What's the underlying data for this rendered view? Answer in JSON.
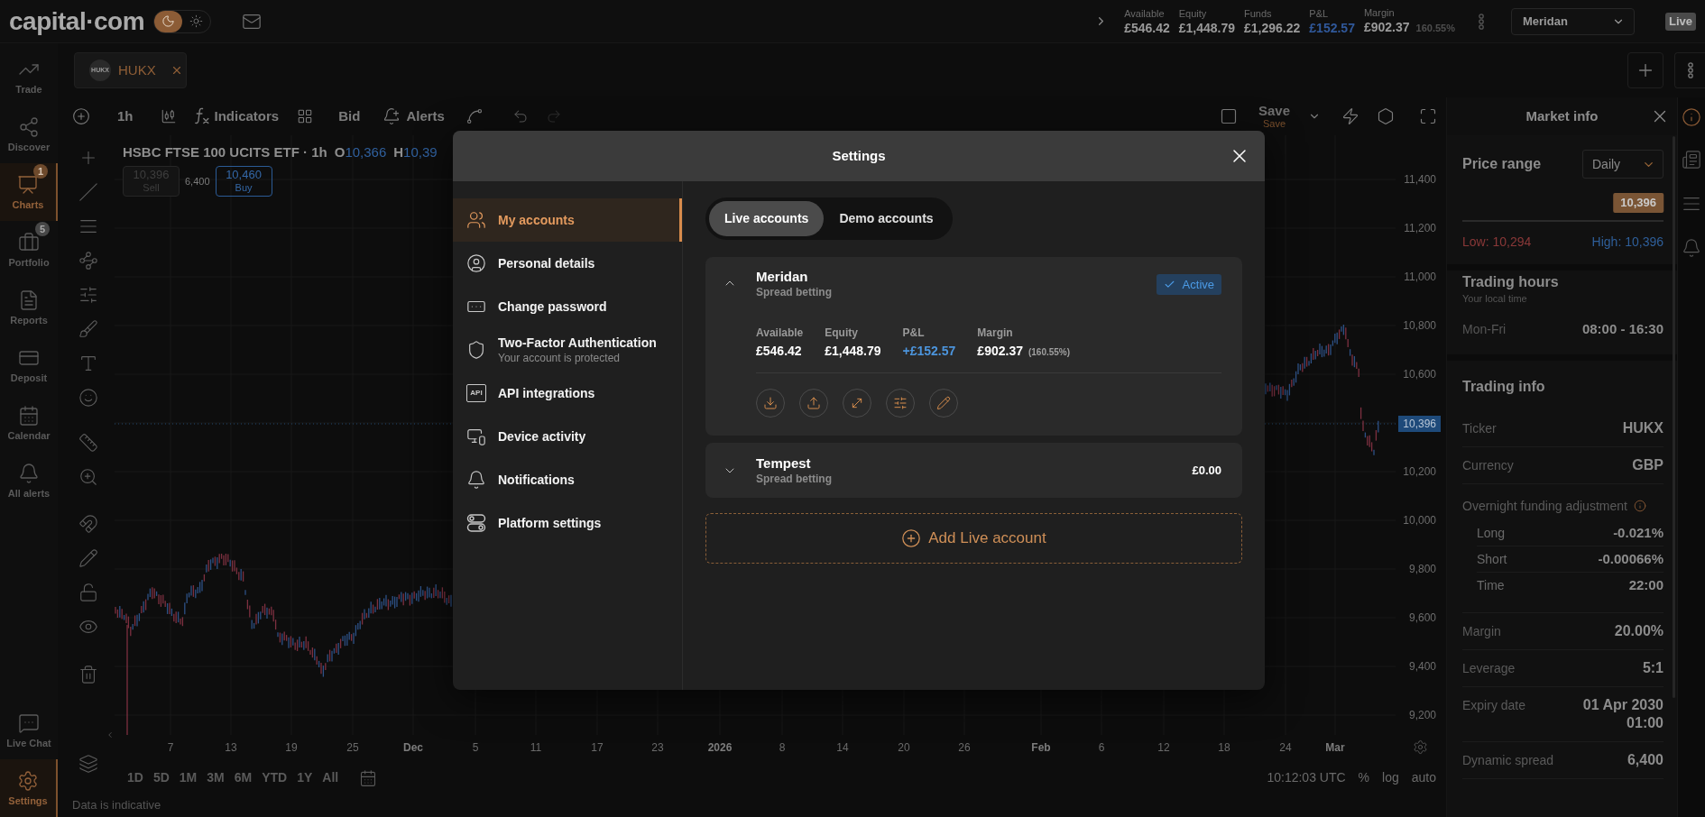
{
  "top_bar": {
    "logo": "capital·com",
    "theme_toggle": [
      {
        "kind": "dark",
        "selected": true
      },
      {
        "kind": "light",
        "selected": false
      }
    ],
    "summary": [
      {
        "label": "Available",
        "value": "£546.42",
        "kind": "amount"
      },
      {
        "label": "Equity",
        "value": "£1,448.79",
        "kind": "amount"
      },
      {
        "label": "Funds",
        "value": "£1,296.22",
        "kind": "amount"
      },
      {
        "label": "P&L",
        "value": "£152.57",
        "kind": "profit"
      },
      {
        "label": "Margin",
        "value": "£902.37",
        "note": "160.55%",
        "kind": "amount"
      }
    ],
    "account_select": {
      "value": "Meridan"
    },
    "mode_badge": "Live"
  },
  "sidebar": {
    "items": [
      {
        "label": "Trade",
        "selected": false
      },
      {
        "label": "Discover",
        "selected": false
      },
      {
        "label": "Charts",
        "selected": true,
        "badge": "1"
      },
      {
        "label": "Portfolio",
        "selected": false,
        "badge": "5"
      },
      {
        "label": "Reports",
        "selected": false
      },
      {
        "label": "Deposit",
        "selected": false
      },
      {
        "label": "Calendar",
        "selected": false
      },
      {
        "label": "All alerts",
        "selected": false
      }
    ],
    "bottom_items": [
      {
        "label": "Live Chat",
        "selected": false
      },
      {
        "label": "Settings",
        "selected": true
      }
    ]
  },
  "instrument_tabs": [
    {
      "symbol": "HUKX",
      "label": "HUKX",
      "selected": true
    }
  ],
  "chart_toolbar": {
    "interval": "1h",
    "indicators": "Indicators",
    "price_type": "Bid",
    "alerts": "Alerts",
    "undo_enabled": true,
    "redo_enabled": false,
    "save": {
      "label": "Save",
      "sublabel": "Save"
    }
  },
  "chart": {
    "title": "HSBC FTSE 100 UCITS ETF · 1h",
    "ohlc": [
      {
        "key": "O",
        "value": "10,366"
      },
      {
        "key": "H",
        "value": "10,39"
      }
    ],
    "sell": {
      "price": "10,396",
      "label": "Sell",
      "enabled": false
    },
    "spread": "6,400",
    "buy": {
      "price": "10,460",
      "label": "Buy",
      "enabled": true
    },
    "price_axis": [
      "11,400",
      "11,200",
      "11,000",
      "10,800",
      "10,600",
      "10,200",
      "10,000",
      "9,800",
      "9,600",
      "9,400",
      "9,200"
    ],
    "current_price": "10,396",
    "time_axis": [
      {
        "label": "7",
        "kind": "day"
      },
      {
        "label": "13",
        "kind": "day"
      },
      {
        "label": "19",
        "kind": "day"
      },
      {
        "label": "25",
        "kind": "day"
      },
      {
        "label": "Dec",
        "kind": "month"
      },
      {
        "label": "5",
        "kind": "day"
      },
      {
        "label": "11",
        "kind": "day"
      },
      {
        "label": "17",
        "kind": "day"
      },
      {
        "label": "23",
        "kind": "day"
      },
      {
        "label": "2026",
        "kind": "year"
      },
      {
        "label": "8",
        "kind": "day"
      },
      {
        "label": "14",
        "kind": "day"
      },
      {
        "label": "20",
        "kind": "day"
      },
      {
        "label": "26",
        "kind": "day"
      },
      {
        "label": "Feb",
        "kind": "month"
      },
      {
        "label": "6",
        "kind": "day"
      },
      {
        "label": "12",
        "kind": "day"
      },
      {
        "label": "18",
        "kind": "day"
      },
      {
        "label": "24",
        "kind": "day"
      },
      {
        "label": "Mar",
        "kind": "month"
      }
    ],
    "periods": [
      "1D",
      "5D",
      "1M",
      "3M",
      "6M",
      "YTD",
      "1Y",
      "All"
    ],
    "clock": "10:12:03 UTC",
    "scale_options": [
      "%",
      "log",
      "auto"
    ],
    "footnote": "Data is indicative"
  },
  "market_info": {
    "title": "Market info",
    "price_range": {
      "title": "Price range",
      "period": "Daily",
      "current": "10,396",
      "level": 1,
      "low": "Low: 10,294",
      "high": "High: 10,396"
    },
    "trading_hours": {
      "title": "Trading hours",
      "subtitle": "Your local time",
      "rows": [
        {
          "label": "Mon-Fri",
          "value": "08:00 - 16:30"
        }
      ]
    },
    "trading_info": {
      "title": "Trading info",
      "rows": [
        {
          "label": "Ticker",
          "value": "HUKX"
        },
        {
          "label": "Currency",
          "value": "GBP"
        },
        {
          "label": "Overnight funding adjustment",
          "info": true,
          "children": [
            {
              "label": "Long",
              "value": "-0.021%"
            },
            {
              "label": "Short",
              "value": "-0.00066%"
            },
            {
              "label": "Time",
              "value": "22:00"
            }
          ]
        },
        {
          "label": "Margin",
          "value": "20.00%"
        },
        {
          "label": "Leverage",
          "value": "5:1"
        },
        {
          "label": "Expiry date",
          "value": "01 Apr 2030 01:00"
        },
        {
          "label": "Dynamic spread",
          "value": "6,400"
        }
      ]
    }
  },
  "settings_dialog": {
    "title": "Settings",
    "nav": [
      {
        "label": "My accounts",
        "selected": true
      },
      {
        "label": "Personal details",
        "selected": false
      },
      {
        "label": "Change password",
        "selected": false
      },
      {
        "label": "Two-Factor Authentication",
        "subtitle": "Your account is protected",
        "selected": false
      },
      {
        "label": "API integrations",
        "icon_text": "API",
        "selected": false
      },
      {
        "label": "Device activity",
        "selected": false
      },
      {
        "label": "Notifications",
        "selected": false
      },
      {
        "label": "Platform settings",
        "selected": false
      }
    ],
    "account_tabs": [
      {
        "label": "Live accounts",
        "selected": true
      },
      {
        "label": "Demo accounts",
        "selected": false
      }
    ],
    "accounts": [
      {
        "name": "Meridan",
        "type": "Spread betting",
        "expanded": true,
        "active": true,
        "status": "Active",
        "stats": [
          {
            "label": "Available",
            "value": "£546.42",
            "kind": "amount"
          },
          {
            "label": "Equity",
            "value": "£1,448.79",
            "kind": "amount"
          },
          {
            "label": "P&L",
            "value": "+£152.57",
            "kind": "profit"
          },
          {
            "label": "Margin",
            "value": "£902.37",
            "note": "(160.55%)",
            "kind": "amount"
          }
        ]
      },
      {
        "name": "Tempest",
        "type": "Spread betting",
        "expanded": false,
        "active": false,
        "balance": "£0.00"
      }
    ],
    "add_button": "Add Live account"
  }
}
